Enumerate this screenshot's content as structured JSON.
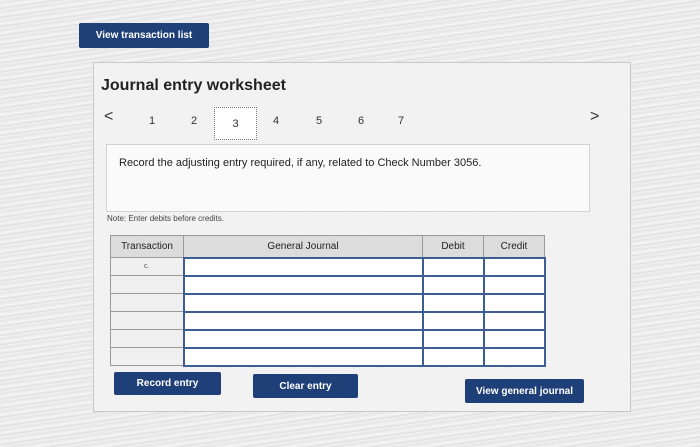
{
  "top": {
    "view_transaction_list_label": "View transaction list"
  },
  "worksheet": {
    "title": "Journal entry worksheet",
    "prev_glyph": "<",
    "next_glyph": ">",
    "steps": [
      "1",
      "2",
      "3",
      "4",
      "5",
      "6",
      "7"
    ],
    "active_step": "3",
    "instruction": "Record the adjusting entry required, if any, related to Check Number 3056.",
    "note": "Note: Enter debits before credits."
  },
  "table": {
    "headers": {
      "transaction": "Transaction",
      "journal": "General Journal",
      "debit": "Debit",
      "credit": "Credit"
    },
    "rows": [
      {
        "transaction": "c.",
        "account": "",
        "debit": "",
        "credit": ""
      },
      {
        "transaction": "",
        "account": "",
        "debit": "",
        "credit": ""
      },
      {
        "transaction": "",
        "account": "",
        "debit": "",
        "credit": ""
      },
      {
        "transaction": "",
        "account": "",
        "debit": "",
        "credit": ""
      },
      {
        "transaction": "",
        "account": "",
        "debit": "",
        "credit": ""
      },
      {
        "transaction": "",
        "account": "",
        "debit": "",
        "credit": ""
      }
    ]
  },
  "buttons": {
    "record_entry": "Record entry",
    "clear_entry": "Clear entry",
    "view_general_journal": "View general journal"
  },
  "colors": {
    "button_bg": "#1f3f78",
    "input_border": "#3d5d93"
  }
}
